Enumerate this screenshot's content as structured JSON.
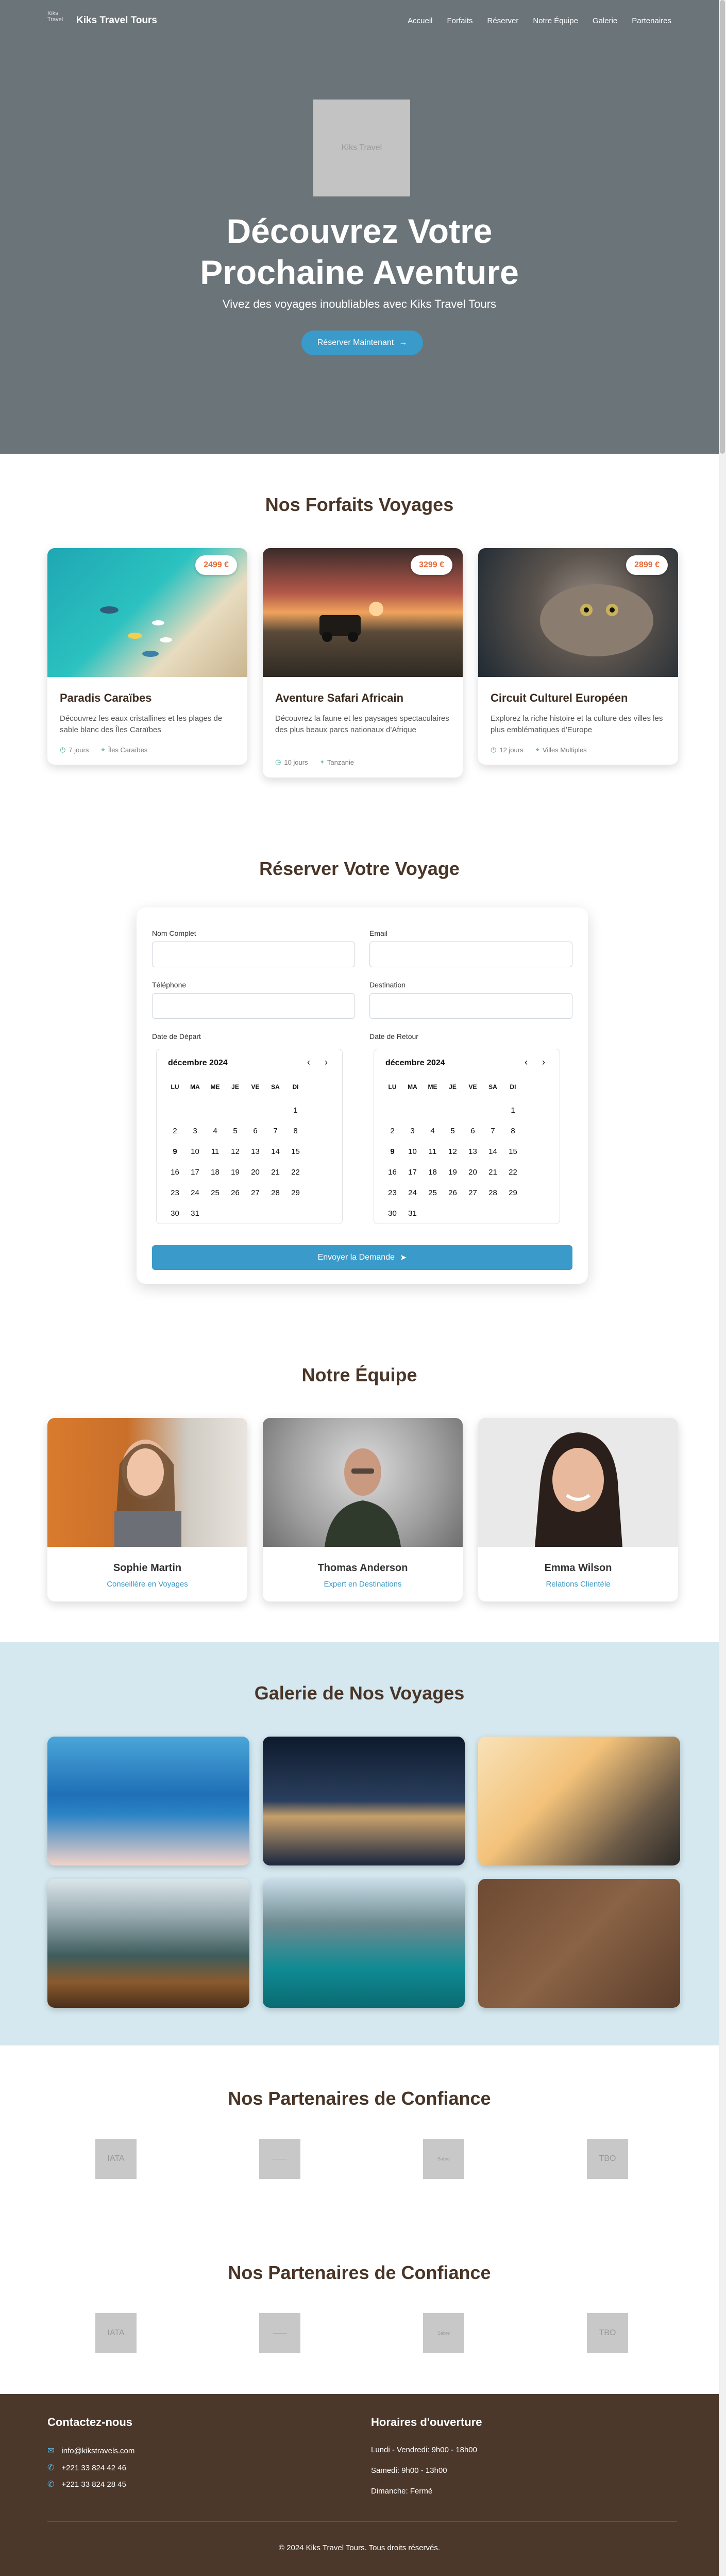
{
  "nav": {
    "logo_alt": "Kiks Travel",
    "brand": "Kiks Travel Tours",
    "links": [
      "Accueil",
      "Forfaits",
      "Réserver",
      "Notre Équipe",
      "Galerie",
      "Partenaires"
    ]
  },
  "hero": {
    "logo_alt": "Kiks Travel",
    "title_line1": "Découvrez Votre",
    "title_line2": "Prochaine Aventure",
    "subtitle": "Vivez des voyages inoubliables avec Kiks Travel Tours",
    "cta": "Réserver Maintenant",
    "bg_color": "#6b7478"
  },
  "packages": {
    "title": "Nos Forfaits Voyages",
    "items": [
      {
        "name": "Paradis Caraïbes",
        "price": "2499 €",
        "description": "Découvrez les eaux cristallines et les plages de sable blanc des Îles Caraïbes",
        "duration": "7 jours",
        "location": "Îles Caraïbes"
      },
      {
        "name": "Aventure Safari Africain",
        "price": "3299 €",
        "description": "Découvrez la faune et les paysages spectaculaires des plus beaux parcs nationaux d'Afrique",
        "duration": "10 jours",
        "location": "Tanzanie"
      },
      {
        "name": "Circuit Culturel Européen",
        "price": "2899 €",
        "description": "Explorez la riche histoire et la culture des villes les plus emblématiques d'Europe",
        "duration": "12 jours",
        "location": "Villes Multiples"
      }
    ]
  },
  "booking": {
    "title": "Réserver Votre Voyage",
    "labels": {
      "name": "Nom Complet",
      "email": "Email",
      "phone": "Téléphone",
      "destination": "Destination",
      "departure": "Date de Départ",
      "return": "Date de Retour"
    },
    "calendar_month": "décembre 2024",
    "weekdays": [
      "LU",
      "MA",
      "ME",
      "JE",
      "VE",
      "SA",
      "DI"
    ],
    "submit": "Envoyer la Demande"
  },
  "team": {
    "title": "Notre Équipe",
    "members": [
      {
        "name": "Sophie Martin",
        "role": "Conseillère en Voyages"
      },
      {
        "name": "Thomas Anderson",
        "role": "Expert en Destinations"
      },
      {
        "name": "Emma Wilson",
        "role": "Relations Clientèle"
      }
    ]
  },
  "gallery": {
    "title": "Galerie de Nos Voyages",
    "bg_color": "#d5e8ef"
  },
  "partners": {
    "title": "Nos Partenaires de Confiance",
    "logos": [
      "IATA",
      "———",
      "Sabre",
      "TBO"
    ]
  },
  "partners2": {
    "title": "Nos Partenaires de Confiance",
    "logos": [
      "IATA",
      "———",
      "Sabre",
      "TBO"
    ]
  },
  "footer": {
    "contact_title": "Contactez-nous",
    "email": "info@kikstravels.com",
    "phone1": "+221 33 824 42 46",
    "phone2": "+221 33 824 28 45",
    "hours_title": "Horaires d'ouverture",
    "hours1": "Lundi - Vendredi: 9h00 - 18h00",
    "hours2": "Samedi: 9h00 - 13h00",
    "hours3": "Dimanche: Fermé",
    "copyright": "© 2024 Kiks Travel Tours. Tous droits réservés.",
    "bg_color": "#4b382b"
  },
  "colors": {
    "accent": "#3a9ac9",
    "price": "#e46c3c",
    "heading": "#4a3628"
  }
}
